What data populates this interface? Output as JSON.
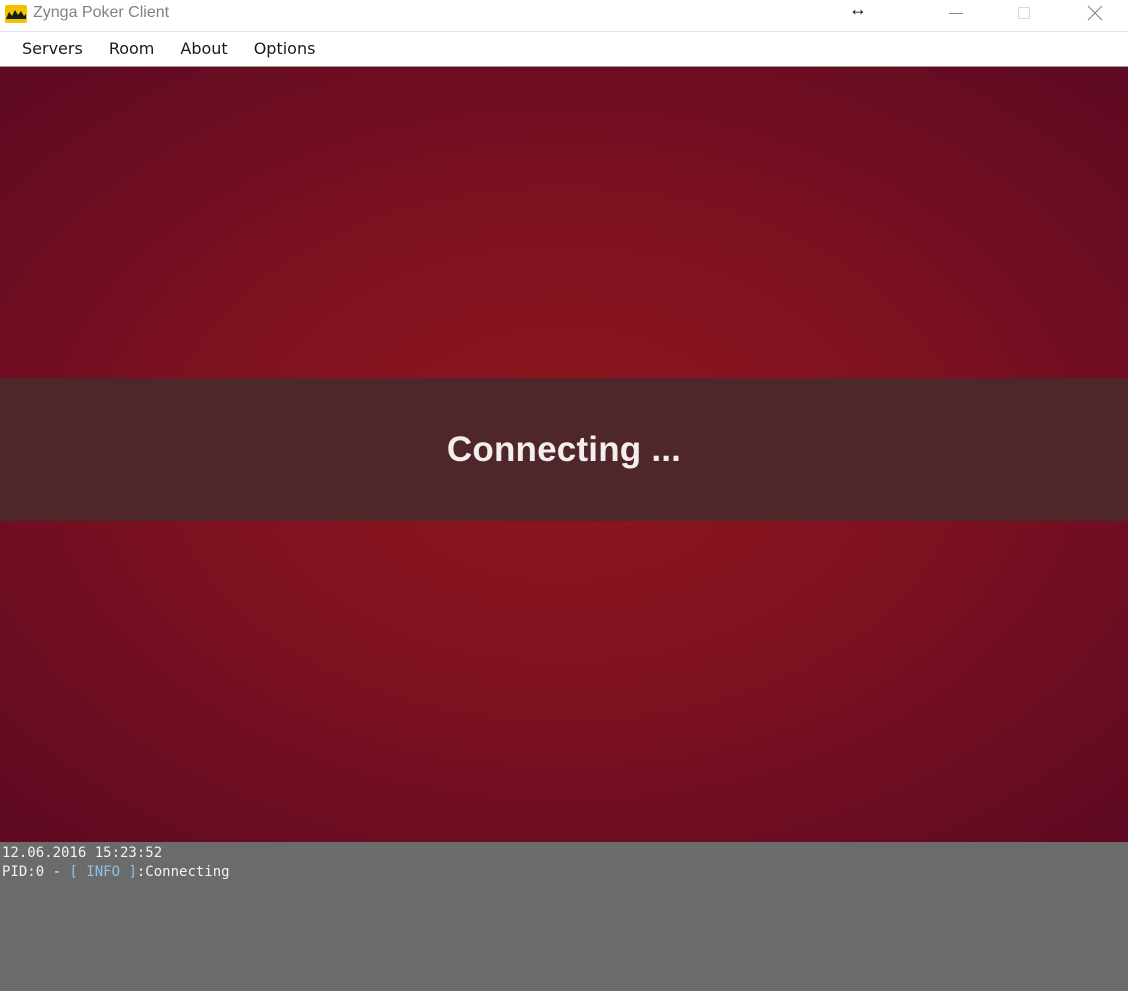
{
  "window": {
    "title": "Zynga Poker Client",
    "icon": "app-logo-icon",
    "controls": [
      "minimize-icon",
      "maximize-icon",
      "close-icon"
    ]
  },
  "menu": {
    "items": [
      {
        "label": "Servers"
      },
      {
        "label": "Room"
      },
      {
        "label": "About"
      },
      {
        "label": "Options"
      }
    ]
  },
  "main": {
    "status_text": "Connecting ..."
  },
  "log": {
    "timestamp": "12.06.2016 15:23:52",
    "pid": "PID:0 - ",
    "bracket_open": "[ ",
    "level": "INFO",
    "bracket_close": " ]",
    "message": ":Connecting"
  },
  "colors": {
    "main_background": "#8f161e",
    "banner_background": "#4f262a",
    "log_background": "#6b6b6b",
    "log_level": "#8fc3e8"
  }
}
